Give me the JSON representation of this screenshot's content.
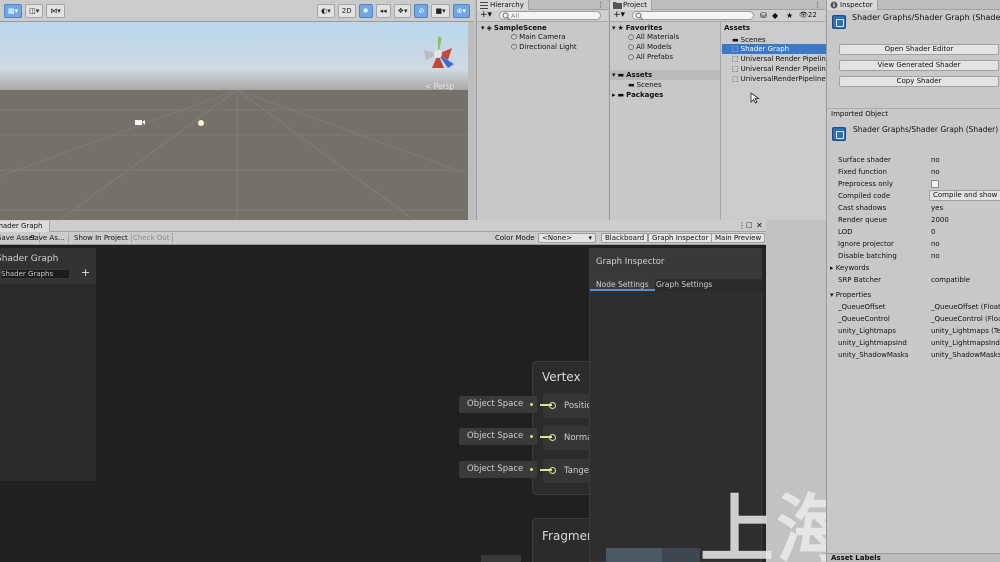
{
  "scene": {
    "toolbar": {
      "view2d": "2D"
    },
    "persp_label": "< Persp"
  },
  "hierarchy": {
    "tab": "Hierarchy",
    "search_placeholder": "All",
    "scene_name": "SampleScene",
    "items": [
      "Main Camera",
      "Directional Light"
    ]
  },
  "project": {
    "tab": "Project",
    "badge": "22",
    "favorites": "Favorites",
    "fav_items": [
      "All Materials",
      "All Models",
      "All Prefabs"
    ],
    "assets_label": "Assets",
    "assets_children": [
      "Scenes"
    ],
    "packages_label": "Packages",
    "assets_header": "Assets",
    "asset_items": [
      "Scenes",
      "Shader Graph",
      "Universal Render Pipeline",
      "Universal Render Pipeline",
      "UniversalRenderPipeline"
    ]
  },
  "shader_graph": {
    "tab": "Shader Graph",
    "toolbar": {
      "save_asset": "Save Asset",
      "save_as": "Save As...",
      "show_in_project": "Show In Project",
      "check_out": "Check Out"
    },
    "color_mode_label": "Color Mode",
    "color_mode_value": "<None>",
    "toggles": {
      "blackboard": "Blackboard",
      "graph_inspector": "Graph Inspector",
      "main_preview": "Main Preview"
    },
    "blackboard": {
      "title": "Shader Graph",
      "subtitle": "Shader Graphs"
    },
    "vertex_node": {
      "title": "Vertex",
      "ports": [
        "Position",
        "Normal",
        "Tangent"
      ],
      "spaces": [
        "Object Space",
        "Object Space",
        "Object Space"
      ]
    },
    "fragment_node": {
      "title": "Fragment"
    },
    "graph_inspector": {
      "title": "Graph Inspector",
      "tabs": [
        "Node Settings",
        "Graph Settings"
      ]
    },
    "watermark": "上海遥知"
  },
  "inspector": {
    "tab": "Inspector",
    "asset_path": "Shader Graphs/Shader Graph (Shader)",
    "buttons": [
      "Open Shader Editor",
      "View Generated Shader",
      "Copy Shader"
    ],
    "imported_object_label": "Imported Object",
    "imported_path": "Shader Graphs/Shader Graph (Shader)",
    "props": [
      {
        "label": "Surface shader",
        "value": "no"
      },
      {
        "label": "Fixed function",
        "value": "no"
      },
      {
        "label": "Preprocess only",
        "value": ""
      },
      {
        "label": "Compiled code",
        "value": "Compile and show code"
      },
      {
        "label": "Cast shadows",
        "value": "yes"
      },
      {
        "label": "Render queue",
        "value": "2000"
      },
      {
        "label": "LOD",
        "value": "0"
      },
      {
        "label": "Ignore projector",
        "value": "no"
      },
      {
        "label": "Disable batching",
        "value": "no"
      },
      {
        "label": "Keywords",
        "value": ""
      },
      {
        "label": "SRP Batcher",
        "value": "compatible"
      }
    ],
    "properties_label": "Properties",
    "properties": [
      {
        "label": "_QueueOffset",
        "value": "_QueueOffset (Float)"
      },
      {
        "label": "_QueueControl",
        "value": "_QueueControl (Float)"
      },
      {
        "label": "unity_Lightmaps",
        "value": "unity_Lightmaps (Tex)"
      },
      {
        "label": "unity_LightmapsInd",
        "value": "unity_LightmapsInd (Tex)"
      },
      {
        "label": "unity_ShadowMasks",
        "value": "unity_ShadowMasks (Tex)"
      }
    ],
    "asset_labels": "Asset Labels"
  },
  "colors": {
    "accent": "#3b79c6",
    "wire": "#d6e58a",
    "graph_bg": "#202020"
  }
}
